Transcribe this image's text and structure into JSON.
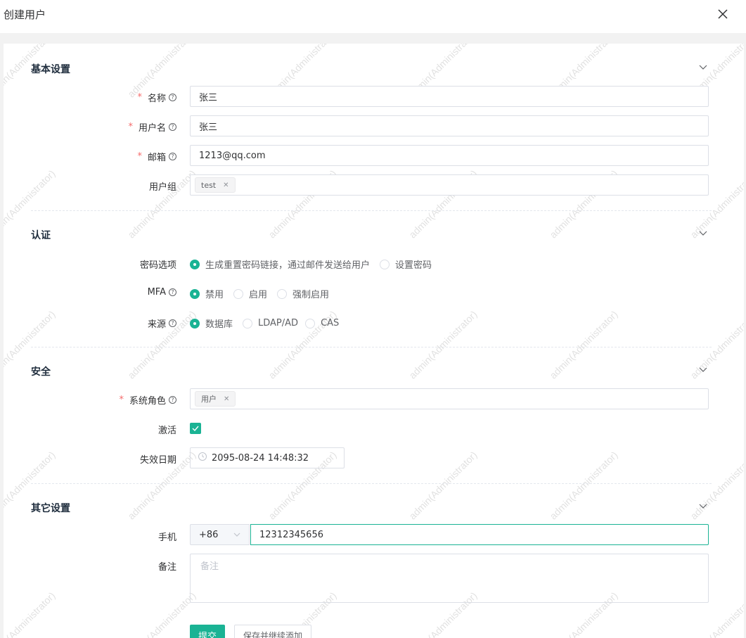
{
  "dialog": {
    "title": "创建用户"
  },
  "watermark": "admin(Administrator)",
  "sections": {
    "basic": "基本设置",
    "auth": "认证",
    "security": "安全",
    "other": "其它设置"
  },
  "fields": {
    "name": {
      "label": "名称",
      "value": "张三"
    },
    "username": {
      "label": "用户名",
      "value": "张三"
    },
    "email": {
      "label": "邮箱",
      "value": "1213@qq.com"
    },
    "group": {
      "label": "用户组",
      "tag": "test"
    },
    "password": {
      "label": "密码选项",
      "options": [
        "生成重置密码链接，通过邮件发送给用户",
        "设置密码"
      ],
      "selected": "生成重置密码链接，通过邮件发送给用户"
    },
    "mfa": {
      "label": "MFA",
      "options": [
        "禁用",
        "启用",
        "强制启用"
      ],
      "selected": "禁用"
    },
    "source": {
      "label": "来源",
      "options": [
        "数据库",
        "LDAP/AD",
        "CAS"
      ],
      "selected": "数据库"
    },
    "role": {
      "label": "系统角色",
      "tag": "用户"
    },
    "active": {
      "label": "激活",
      "checked": true
    },
    "expire": {
      "label": "失效日期",
      "value": "2095-08-24 14:48:32"
    },
    "phone": {
      "label": "手机",
      "code": "+86",
      "value": "12312345656"
    },
    "comment": {
      "label": "备注",
      "placeholder": "备注"
    }
  },
  "buttons": {
    "submit": "提交",
    "save_continue": "保存并继续添加"
  },
  "colors": {
    "accent": "#1ab394",
    "required": "#f56c6c"
  }
}
